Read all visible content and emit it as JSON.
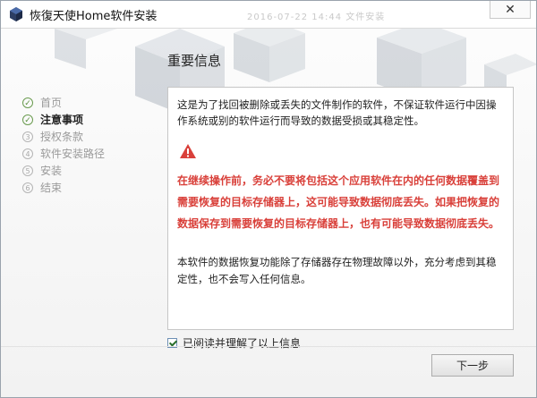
{
  "window": {
    "title": "恢復天使Home软件安装",
    "faint_header": "2016-07-22 14:44 文件安装",
    "close_glyph": "✕"
  },
  "icons": {
    "app": "app-cube-icon",
    "close": "close-icon",
    "warning": "warning-icon",
    "check": "checkmark-icon"
  },
  "sidebar": {
    "steps": [
      {
        "num": "✓",
        "label": "首页"
      },
      {
        "num": "✓",
        "label": "注意事项"
      },
      {
        "num": "3",
        "label": "授权条款"
      },
      {
        "num": "4",
        "label": "软件安装路径"
      },
      {
        "num": "5",
        "label": "安装"
      },
      {
        "num": "6",
        "label": "结束"
      }
    ]
  },
  "main": {
    "title": "重要信息",
    "intro": "这是为了找回被删除或丢失的文件制作的软件，不保证软件运行中因操作系统或别的软件运行而导致的数据受损或其稳定性。",
    "warning": "在继续操作前，务必不要将包括这个应用软件在内的任何数据覆盖到需要恢复的目标存储器上，这可能导致数据彻底丢失。如果把恢复的数据保存到需要恢复的目标存储器上，也有可能导致数据彻底丢失。",
    "outro": "本软件的数据恢复功能除了存储器存在物理故障以外，充分考虑到其稳定性，也不会写入任何信息。"
  },
  "footer": {
    "agree_label": "已阅读并理解了以上信息",
    "agree_checked": true,
    "next_label": "下一步"
  },
  "colors": {
    "warning_red": "#d9403a",
    "step_green": "#5a8f3e"
  }
}
